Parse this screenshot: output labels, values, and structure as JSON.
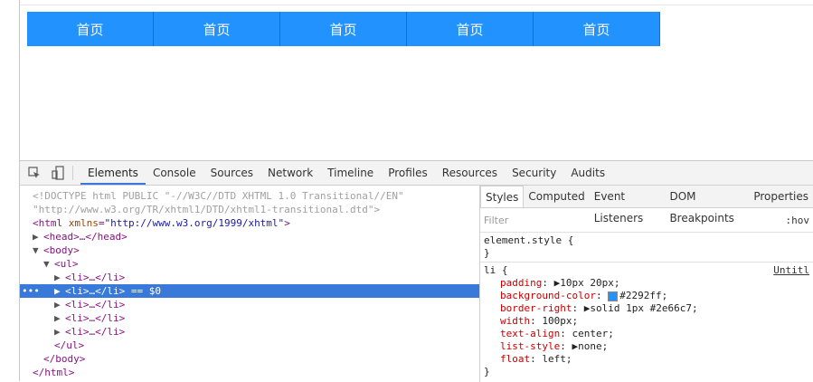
{
  "nav": {
    "items": [
      "首页",
      "首页",
      "首页",
      "首页",
      "首页"
    ]
  },
  "colors": {
    "nav_bg": "#2292ff",
    "nav_border": "#2e66c7",
    "selection": "#3879d9"
  },
  "devtools": {
    "tabs": [
      "Elements",
      "Console",
      "Sources",
      "Network",
      "Timeline",
      "Profiles",
      "Resources",
      "Security",
      "Audits"
    ],
    "active_tab": "Elements",
    "icons": {
      "inspect": "cursor-select-icon",
      "device": "device-mode-icon"
    }
  },
  "dom": {
    "doctype1": "<!DOCTYPE html PUBLIC \"-//W3C//DTD XHTML 1.0 Transitional//EN\"",
    "doctype2": "\"http://www.w3.org/TR/xhtml1/DTD/xhtml1-transitional.dtd\">",
    "html_open_tag": "<html ",
    "html_attr": "xmlns",
    "html_eq": "=",
    "html_val": "\"http://www.w3.org/1999/xhtml\"",
    "html_close_gt": ">",
    "head": "<head>…</head>",
    "body_open": "<body>",
    "ul_open": "<ul>",
    "li": "<li>…</li>",
    "li_selected": "<li>…</li>",
    "selected_marker": " == $0",
    "ul_close": "</ul>",
    "body_close": "</body>",
    "html_close": "</html>"
  },
  "styles": {
    "tabs": [
      "Styles",
      "Computed",
      "Event Listeners",
      "DOM Breakpoints",
      "Properties"
    ],
    "active_tab": "Styles",
    "filter_placeholder": "Filter",
    "hov": ":hov",
    "element_style_open": "element.style {",
    "close_brace": "}",
    "li_selector": "li {",
    "source": "Untitl",
    "declarations": [
      {
        "prop": "padding",
        "value": "▶10px 20px;"
      },
      {
        "prop": "background-color",
        "value": "#2292ff;",
        "swatch": "#2292ff"
      },
      {
        "prop": "border-right",
        "value": "▶solid 1px #2e66c7;",
        "swatch": "#2e66c7"
      },
      {
        "prop": "width",
        "value": "100px;"
      },
      {
        "prop": "text-align",
        "value": "center;"
      },
      {
        "prop": "list-style",
        "value": "▶none;"
      },
      {
        "prop": "float",
        "value": "left;"
      }
    ],
    "last_close": "}"
  }
}
